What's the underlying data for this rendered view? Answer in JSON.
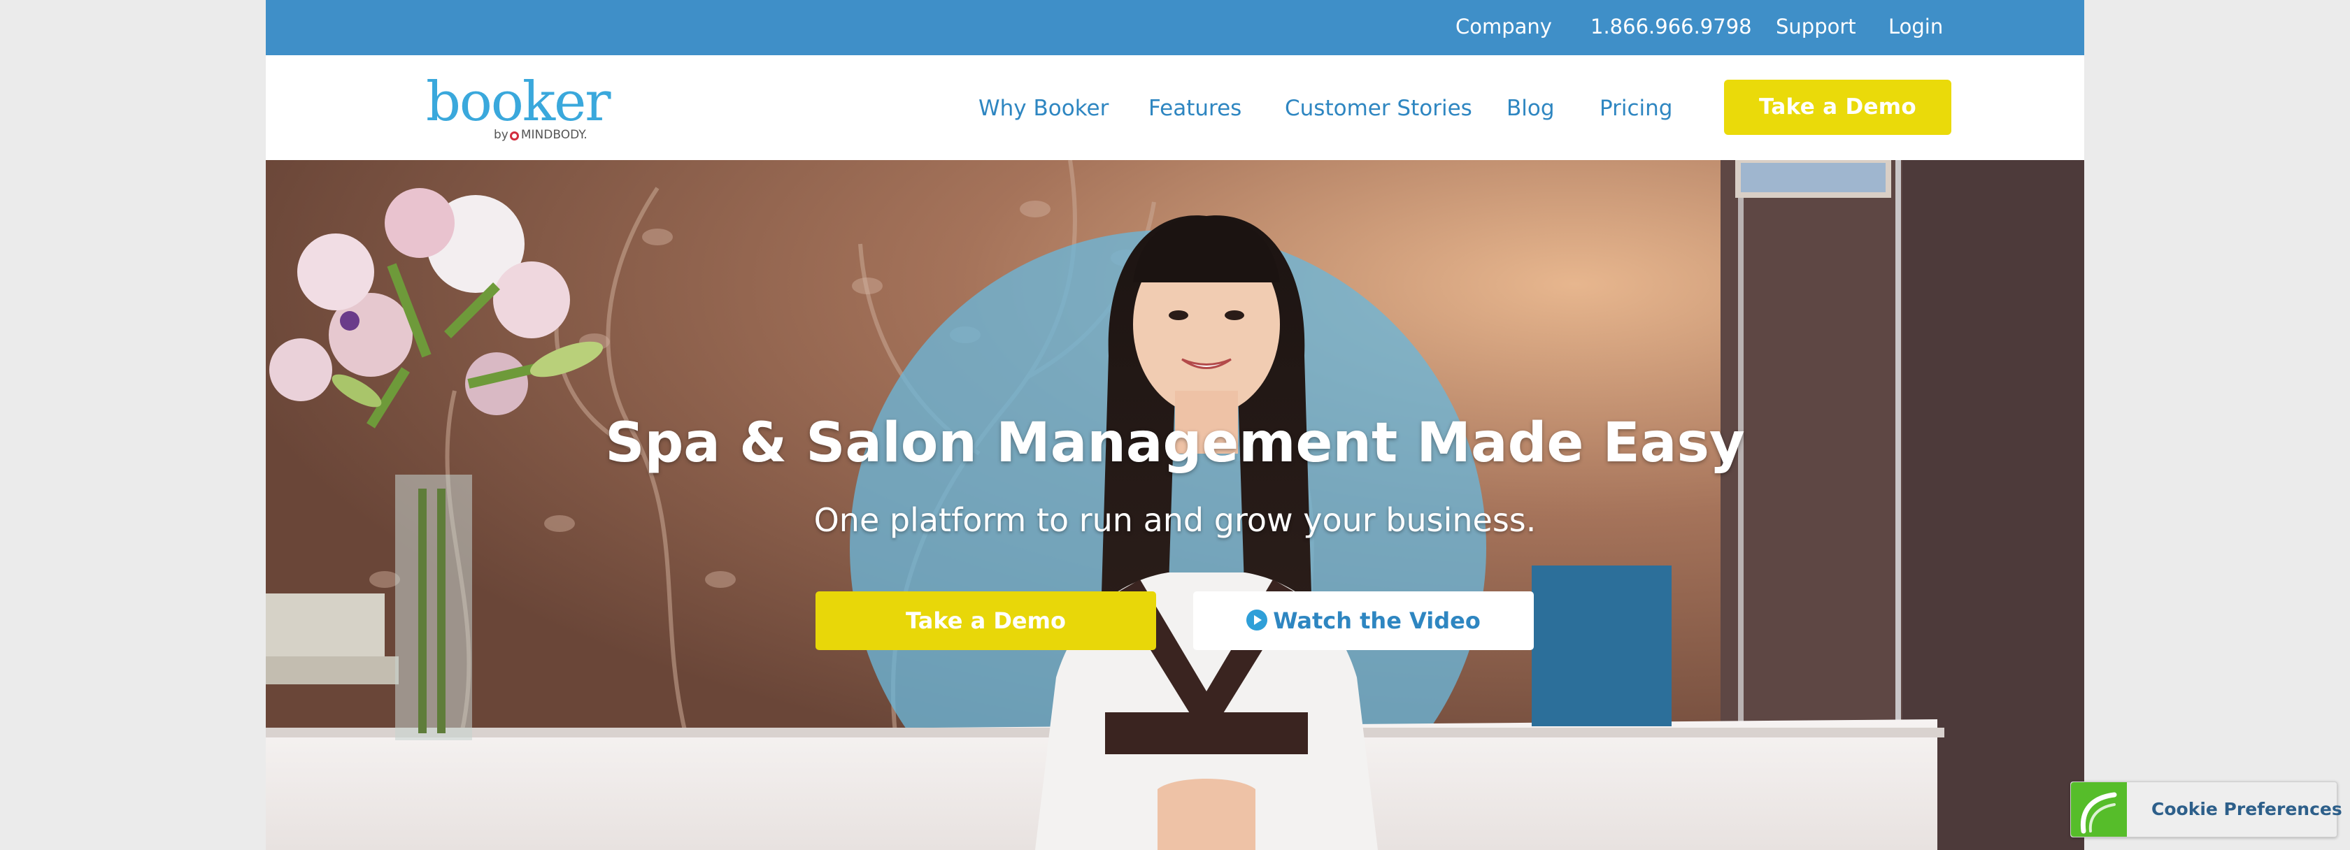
{
  "topbar": {
    "company": "Company",
    "phone": "1.866.966.9798",
    "support": "Support",
    "login": "Login"
  },
  "brand": {
    "name": "booker",
    "by_prefix": "by",
    "by_brand": "MINDBODY."
  },
  "nav": {
    "items": [
      {
        "label": "Why Booker"
      },
      {
        "label": "Features"
      },
      {
        "label": "Customer Stories"
      },
      {
        "label": "Blog"
      },
      {
        "label": "Pricing"
      }
    ],
    "cta": "Take a Demo"
  },
  "hero": {
    "title": "Spa & Salon Management Made Easy",
    "subtitle": "One platform to run and grow your business.",
    "primary_button": "Take a Demo",
    "secondary_button": "Watch the Video"
  },
  "cookie": {
    "label": "Cookie Preferences"
  },
  "colors": {
    "topbar": "#3f8fc8",
    "nav_link": "#2e86c1",
    "cta_yellow": "#eada0a",
    "logo_blue": "#3aa8dc",
    "cookie_green": "#56bd2a"
  },
  "icons": {
    "play": "play-icon",
    "cookie": "cookie-leaf-icon"
  }
}
